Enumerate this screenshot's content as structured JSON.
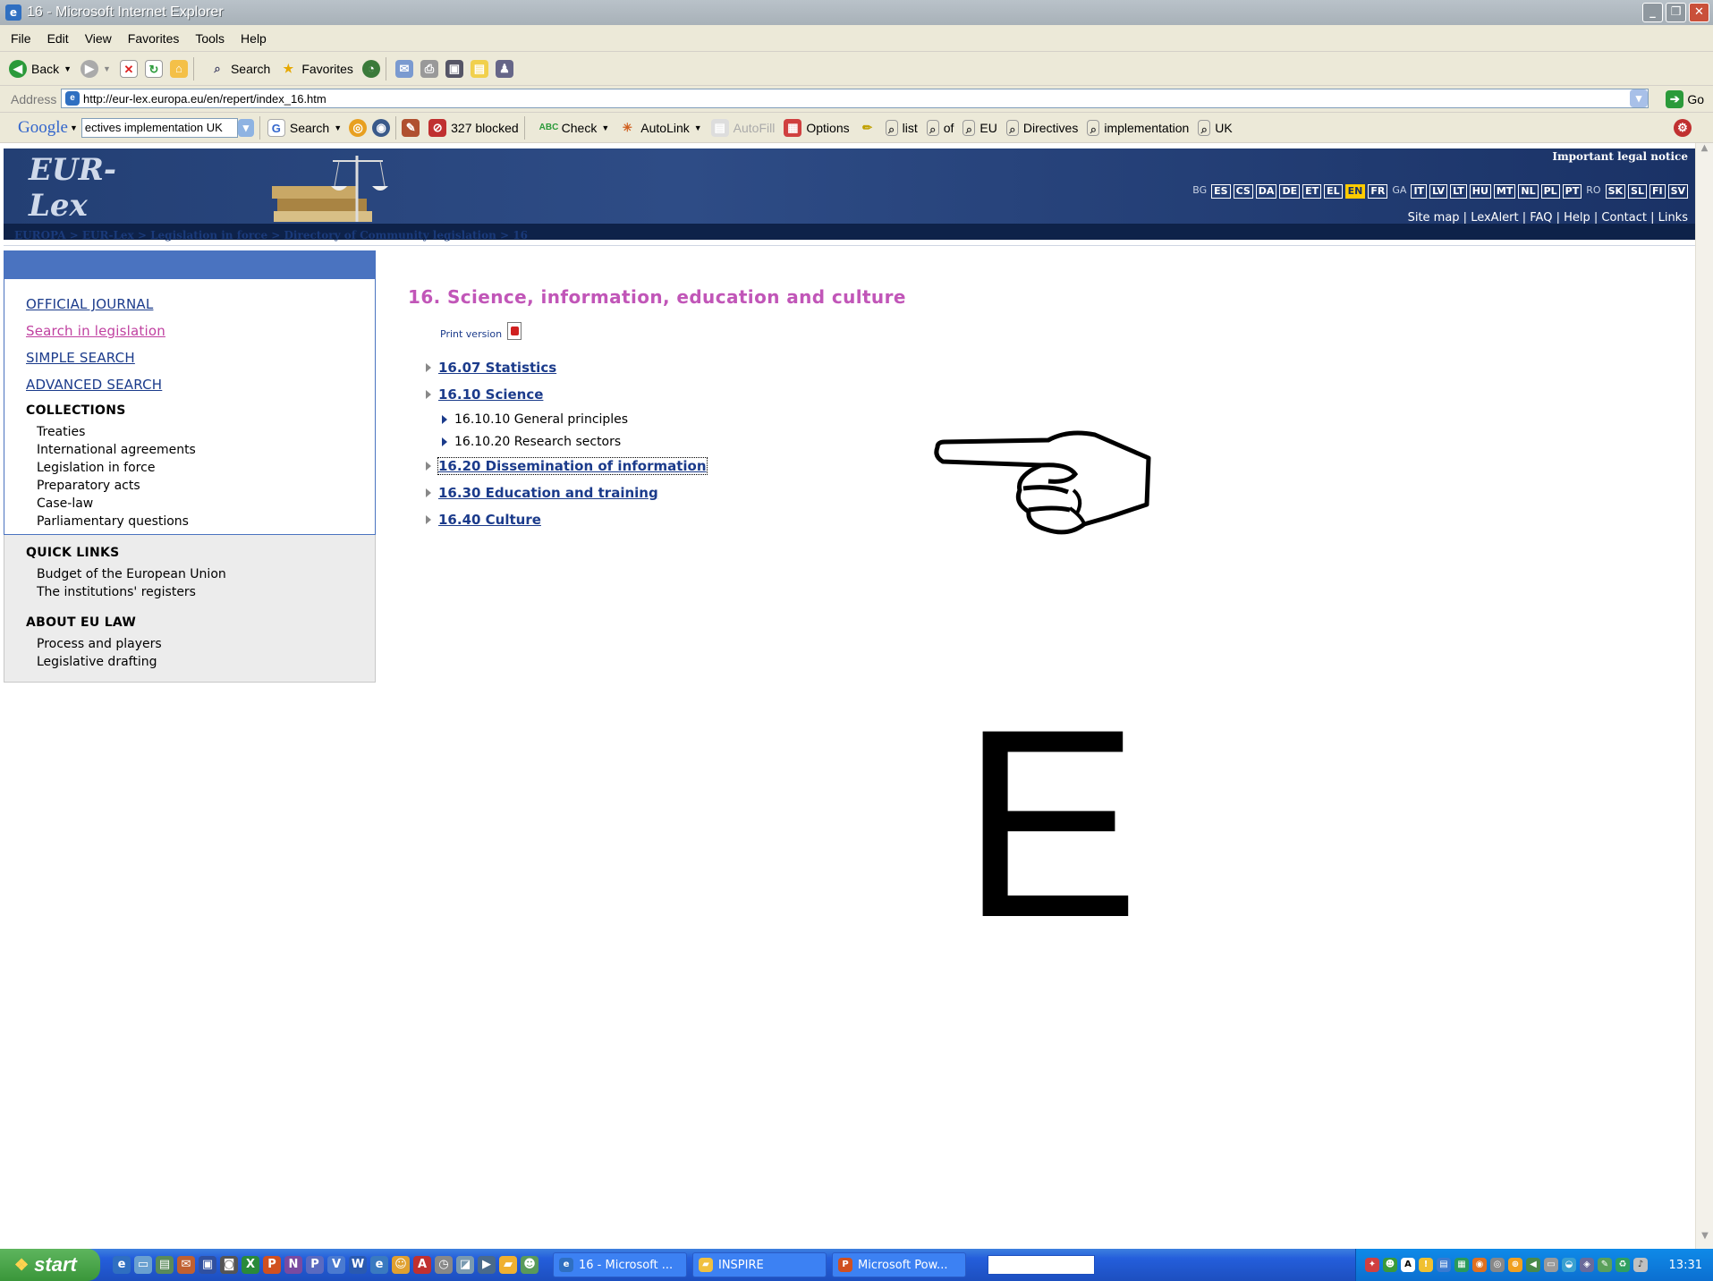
{
  "window": {
    "title": "16 - Microsoft Internet Explorer"
  },
  "menu": [
    "File",
    "Edit",
    "View",
    "Favorites",
    "Tools",
    "Help"
  ],
  "toolbar": {
    "back": "Back",
    "search": "Search",
    "favorites": "Favorites"
  },
  "address": {
    "label": "Address",
    "url": "http://eur-lex.europa.eu/en/repert/index_16.htm",
    "go": "Go"
  },
  "google_bar": {
    "brand": "Google",
    "query": "ectives implementation UK",
    "search": "Search",
    "blocked": "327 blocked",
    "check": "Check",
    "autolink": "AutoLink",
    "autofill": "AutoFill",
    "options": "Options",
    "terms": [
      "list",
      "of",
      "EU",
      "Directives",
      "implementation",
      "UK"
    ]
  },
  "header": {
    "logo": "EUR-Lex",
    "legal": "Important legal notice",
    "languages": [
      {
        "code": "BG",
        "style": "plain"
      },
      {
        "code": "ES",
        "style": "box"
      },
      {
        "code": "CS",
        "style": "box"
      },
      {
        "code": "DA",
        "style": "box"
      },
      {
        "code": "DE",
        "style": "box"
      },
      {
        "code": "ET",
        "style": "box"
      },
      {
        "code": "EL",
        "style": "box"
      },
      {
        "code": "EN",
        "style": "sel"
      },
      {
        "code": "FR",
        "style": "box"
      },
      {
        "code": "GA",
        "style": "plain"
      },
      {
        "code": "IT",
        "style": "box"
      },
      {
        "code": "LV",
        "style": "box"
      },
      {
        "code": "LT",
        "style": "box"
      },
      {
        "code": "HU",
        "style": "box"
      },
      {
        "code": "MT",
        "style": "box"
      },
      {
        "code": "NL",
        "style": "box"
      },
      {
        "code": "PL",
        "style": "box"
      },
      {
        "code": "PT",
        "style": "box"
      },
      {
        "code": "RO",
        "style": "plain"
      },
      {
        "code": "SK",
        "style": "box"
      },
      {
        "code": "SL",
        "style": "box"
      },
      {
        "code": "FI",
        "style": "box"
      },
      {
        "code": "SV",
        "style": "box"
      }
    ],
    "toplinks": "Site map | LexAlert | FAQ | Help | Contact | Links"
  },
  "breadcrumb": "EUROPA > EUR-Lex > Legislation in force > Directory of Community legislation > 16",
  "sidebar": {
    "links": [
      "OFFICIAL JOURNAL",
      "Search in legislation",
      "SIMPLE SEARCH",
      "ADVANCED SEARCH"
    ],
    "collections_title": "COLLECTIONS",
    "collections": [
      "Treaties",
      "International agreements",
      "Legislation in force",
      "Preparatory acts",
      "Case-law",
      "Parliamentary questions"
    ],
    "quick_title": "QUICK LINKS",
    "quick": [
      "Budget of the European Union",
      "The institutions' registers"
    ],
    "about_title": "ABOUT EU LAW",
    "about": [
      "Process and players",
      "Legislative drafting"
    ]
  },
  "content": {
    "title": "16. Science, information, education and culture",
    "print": "Print version",
    "tree": [
      {
        "label": "16.07 Statistics",
        "level": 1
      },
      {
        "label": "16.10 Science",
        "level": 1
      },
      {
        "label": "16.10.10 General principles",
        "level": 2
      },
      {
        "label": "16.10.20 Research sectors",
        "level": 2
      },
      {
        "label": "16.20 Dissemination of information",
        "level": 1,
        "focused": true
      },
      {
        "label": "16.30 Education and training",
        "level": 1
      },
      {
        "label": "16.40 Culture",
        "level": 1
      }
    ],
    "big_letter": "E"
  },
  "taskbar": {
    "start": "start",
    "tasks": [
      "16 - Microsoft ...",
      "INSPIRE",
      "Microsoft Pow..."
    ],
    "clock": "13:31"
  }
}
